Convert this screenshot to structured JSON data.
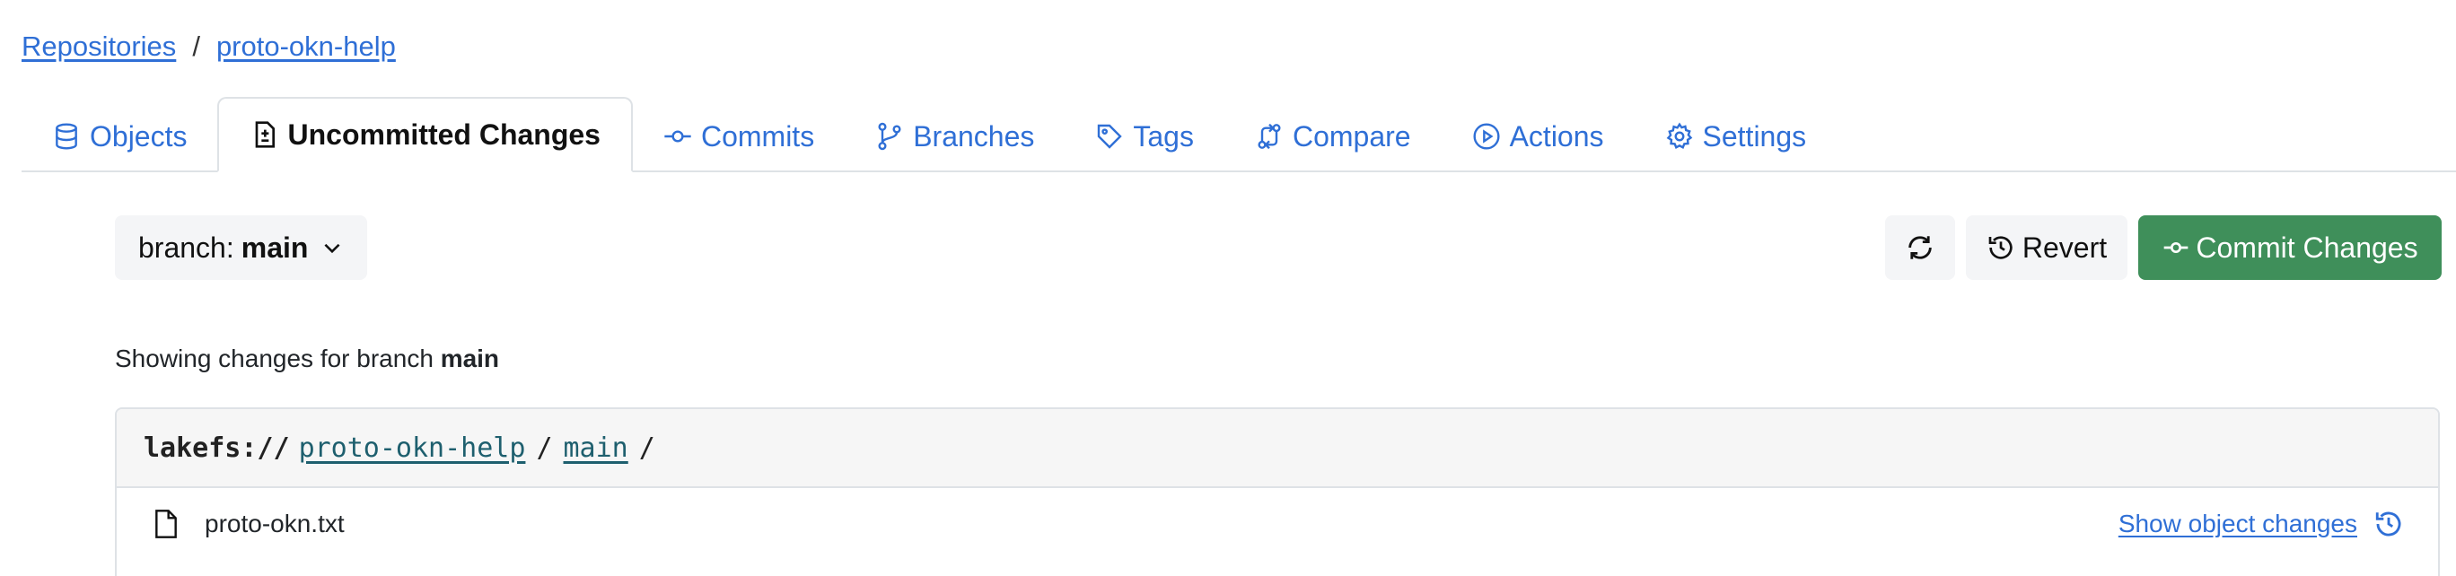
{
  "breadcrumb": {
    "root": "Repositories",
    "separator": "/",
    "repo": "proto-okn-help"
  },
  "tabs": [
    {
      "label": "Objects",
      "icon": "database-icon"
    },
    {
      "label": "Uncommitted Changes",
      "icon": "file-diff-icon",
      "active": true
    },
    {
      "label": "Commits",
      "icon": "git-commit-icon"
    },
    {
      "label": "Branches",
      "icon": "git-branch-icon"
    },
    {
      "label": "Tags",
      "icon": "tag-icon"
    },
    {
      "label": "Compare",
      "icon": "git-compare-icon"
    },
    {
      "label": "Actions",
      "icon": "play-circle-icon"
    },
    {
      "label": "Settings",
      "icon": "gear-icon"
    }
  ],
  "toolbar": {
    "branch_prefix": "branch:",
    "branch_name": "main",
    "revert_label": "Revert",
    "commit_label": "Commit Changes"
  },
  "summary": {
    "text": "Showing changes for branch",
    "branch": "main"
  },
  "path": {
    "protocol": "lakefs://",
    "repo": "proto-okn-help",
    "sep1": "/",
    "branch": "main",
    "sep2": "/"
  },
  "changes": [
    {
      "name": "proto-okn.txt",
      "action_label": "Show object changes"
    }
  ],
  "colors": {
    "link": "#2f6fd6",
    "commit_button": "#3f8f5a",
    "path_link": "#1e5f6e"
  }
}
